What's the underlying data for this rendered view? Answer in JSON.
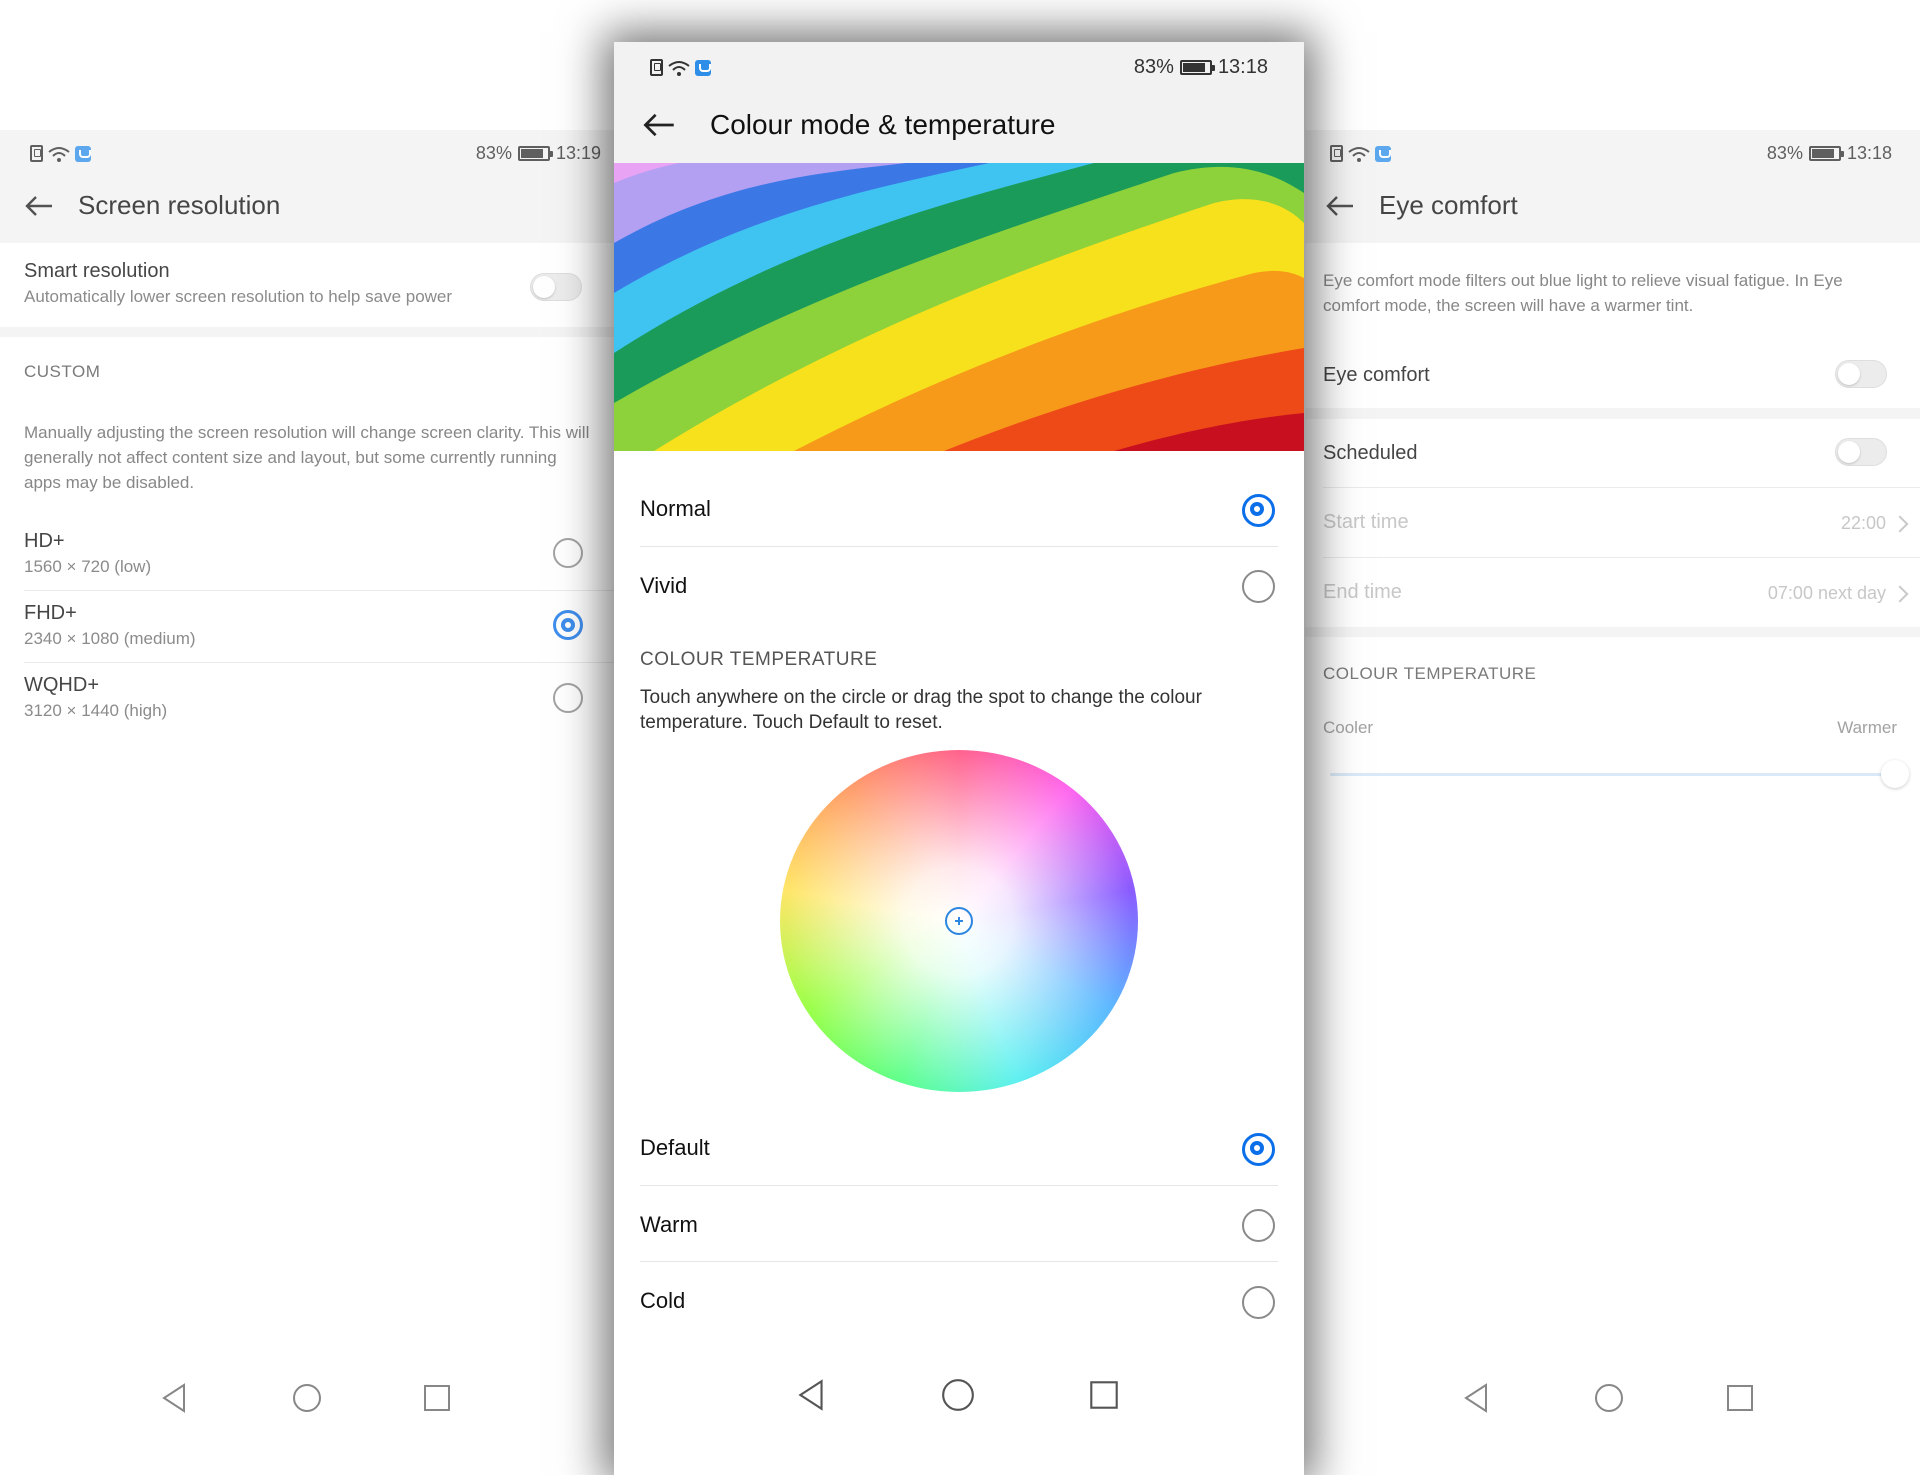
{
  "status_left": {
    "battery": "83%",
    "time": "13:19"
  },
  "status_center": {
    "battery": "83%",
    "time": "13:18"
  },
  "status_right": {
    "battery": "83%",
    "time": "13:18"
  },
  "left": {
    "title": "Screen resolution",
    "smart": {
      "title": "Smart resolution",
      "subtitle": "Automatically lower screen resolution to help save power",
      "enabled": false
    },
    "custom_label": "CUSTOM",
    "custom_text": "Manually adjusting the screen resolution will change screen clarity. This will generally not affect content size and layout, but some currently running apps may be disabled.",
    "options": [
      {
        "title": "HD+",
        "subtitle": "1560 × 720 (low)",
        "selected": false
      },
      {
        "title": "FHD+",
        "subtitle": "2340 × 1080 (medium)",
        "selected": true
      },
      {
        "title": "WQHD+",
        "subtitle": "3120 × 1440 (high)",
        "selected": false
      }
    ]
  },
  "center": {
    "title": "Colour mode & temperature",
    "modes": [
      {
        "label": "Normal",
        "selected": true
      },
      {
        "label": "Vivid",
        "selected": false
      }
    ],
    "temp_label": "COLOUR TEMPERATURE",
    "temp_text": "Touch anywhere on the circle or drag the spot to change the colour temperature. Touch Default to reset.",
    "presets": [
      {
        "label": "Default",
        "selected": true
      },
      {
        "label": "Warm",
        "selected": false
      },
      {
        "label": "Cold",
        "selected": false
      }
    ]
  },
  "right": {
    "title": "Eye comfort",
    "intro": "Eye comfort mode filters out blue light to relieve visual fatigue. In Eye comfort mode, the screen will have a warmer tint.",
    "eye_comfort": {
      "label": "Eye comfort",
      "enabled": false
    },
    "scheduled": {
      "label": "Scheduled",
      "enabled": false
    },
    "start_time": {
      "label": "Start time",
      "value": "22:00"
    },
    "end_time": {
      "label": "End time",
      "value": "07:00 next day"
    },
    "temp_label": "COLOUR TEMPERATURE",
    "cooler": "Cooler",
    "warmer": "Warmer",
    "slider_value": 1.0
  },
  "colors": {
    "accent": "#0a6fe8",
    "header_bg": "#f2f2f2"
  },
  "icons": [
    "sim-icon",
    "wifi-icon",
    "app-notification-icon",
    "battery-icon",
    "back-arrow-icon",
    "nav-back-icon",
    "nav-home-icon",
    "nav-recents-icon"
  ]
}
